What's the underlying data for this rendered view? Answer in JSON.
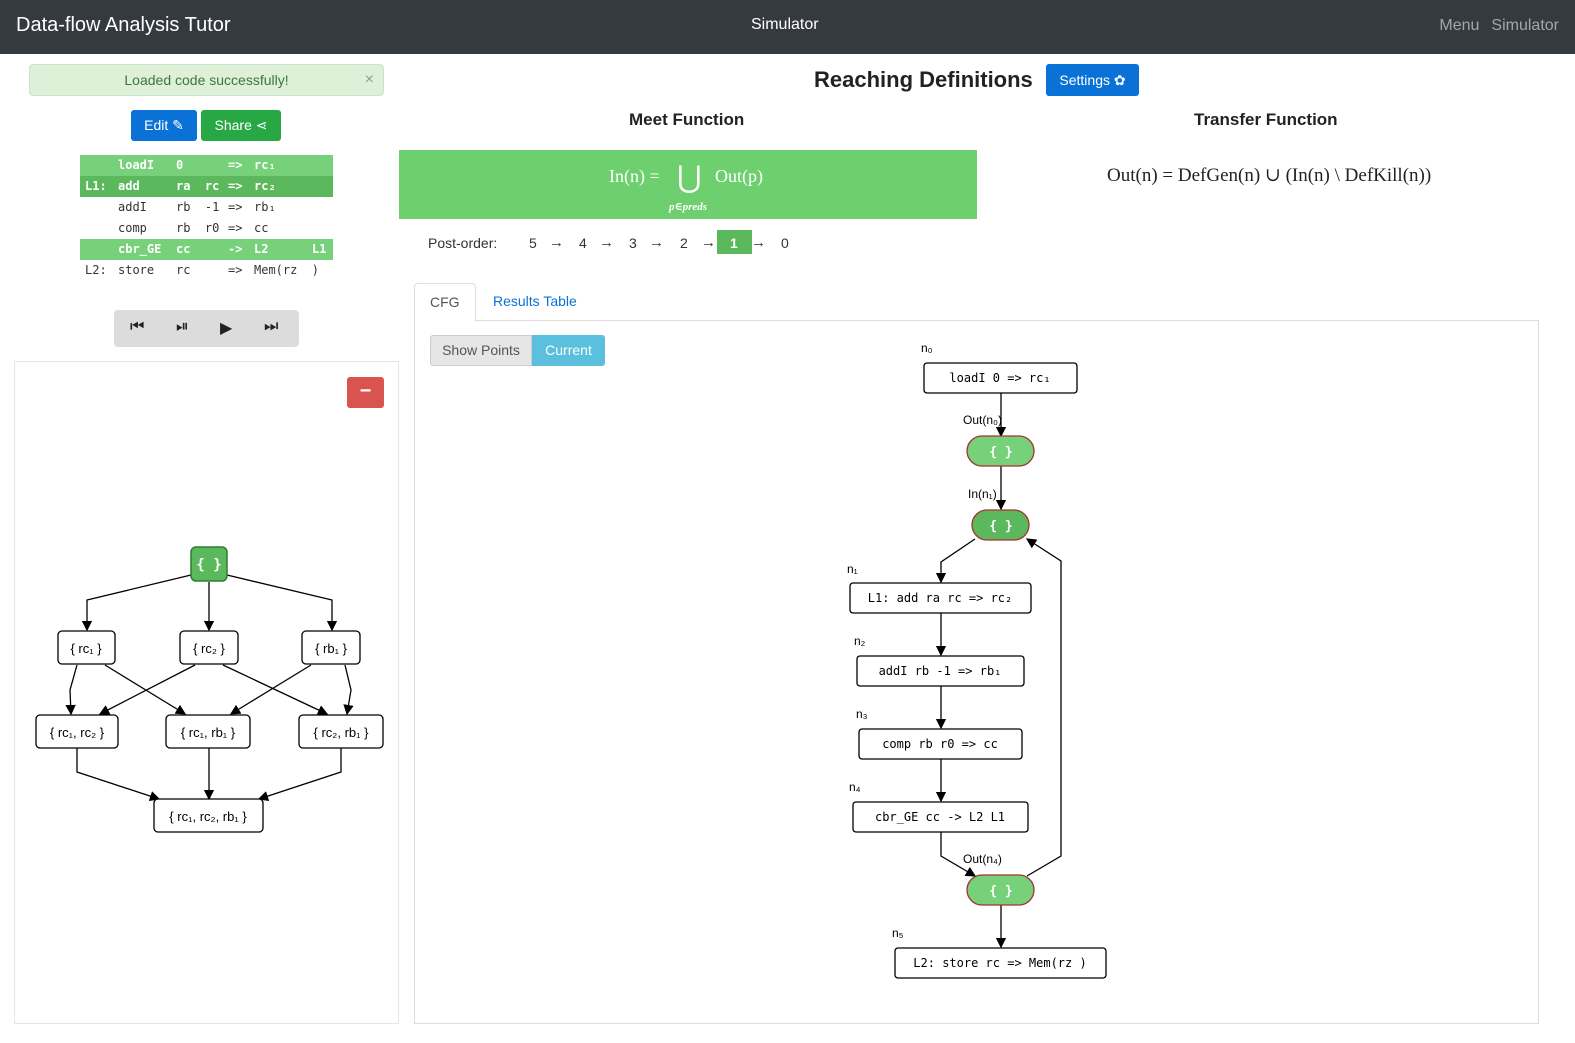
{
  "navbar": {
    "brand": "Data-flow Analysis Tutor",
    "center_title": "Simulator",
    "menu_label": "Menu",
    "simulator_label": "Simulator"
  },
  "alert": {
    "message": "Loaded code successfully!",
    "close": "×"
  },
  "toolbar": {
    "edit_label": "Edit ✎",
    "share_label": "Share ⋖"
  },
  "code_lines": [
    {
      "label": "",
      "op": "loadI",
      "args": "0",
      "arrow": "=>",
      "dest": "rc₁",
      "extra": "",
      "highlight": "light"
    },
    {
      "label": "L1:",
      "op": "add",
      "args": "ra  rc",
      "arrow": "=>",
      "dest": "rc₂",
      "extra": "",
      "highlight": "dark"
    },
    {
      "label": "",
      "op": "addI",
      "args": "rb  -1",
      "arrow": "=>",
      "dest": "rb₁",
      "extra": "",
      "highlight": "none"
    },
    {
      "label": "",
      "op": "comp",
      "args": "rb  r0",
      "arrow": "=>",
      "dest": "cc",
      "extra": "",
      "highlight": "none"
    },
    {
      "label": "",
      "op": "cbr_GE",
      "args": "cc",
      "arrow": "->",
      "dest": "L2",
      "extra": "L1",
      "highlight": "light"
    },
    {
      "label": "L2:",
      "op": "store",
      "args": "rc",
      "arrow": "=>",
      "dest": "Mem(rz  )",
      "extra": "",
      "highlight": "none"
    }
  ],
  "player": {
    "first": "⏮",
    "step": "⏯",
    "play": "▶",
    "last": "⏭"
  },
  "lattice": {
    "minus_label": "−",
    "top": "{ }",
    "level1": [
      "{ rc₁ }",
      "{ rc₂ }",
      "{ rb₁ }"
    ],
    "level2": [
      "{ rc₁, rc₂ }",
      "{ rc₁, rb₁ }",
      "{ rc₂, rb₁ }"
    ],
    "bottom": "{ rc₁, rc₂, rb₁ }"
  },
  "analysis": {
    "title": "Reaching Definitions",
    "settings_label": "Settings ✿",
    "meet_title": "Meet Function",
    "transfer_title": "Transfer Function",
    "meet_lhs": "In(n) =",
    "meet_cup": "⋃",
    "meet_sub": "p∈preds",
    "meet_rhs": "Out(p)",
    "transfer_formula": "Out(n) = DefGen(n) ∪ (In(n) \\ DefKill(n))"
  },
  "postorder": {
    "label": "Post-order:",
    "items": [
      "5",
      "4",
      "3",
      "2",
      "1",
      "0"
    ],
    "arrow": "→",
    "active_index": 4
  },
  "tabs": {
    "cfg": "CFG",
    "results": "Results Table"
  },
  "cfg_controls": {
    "show_points": "Show Points",
    "current": "Current"
  },
  "cfg": {
    "n0_label": "n₀",
    "n0_code": "loadI  0   =>  rc₁",
    "out_n0_label": "Out(n₀)",
    "out_n0_set": "{ }",
    "in_n1_label": "In(n₁)",
    "in_n1_set": "{ }",
    "n1_label": "n₁",
    "n1_code": "L1:  add  ra  rc  =>  rc₂",
    "n2_label": "n₂",
    "n2_code": "addI  rb  -1  =>  rb₁",
    "n3_label": "n₃",
    "n3_code": "comp  rb  r0  =>  cc",
    "n4_label": "n₄",
    "n4_code": "cbr_GE  cc   ->  L2  L1",
    "out_n4_label": "Out(n₄)",
    "out_n4_set": "{ }",
    "n5_label": "n₅",
    "n5_code": "L2:  store  rc   =>  Mem(rz  )"
  },
  "colors": {
    "navbar": "#343a40",
    "primary": "#0a72d6",
    "success": "#28a745",
    "highlight_light": "#76d17a",
    "highlight_dark": "#5cb85c",
    "danger": "#d9534f",
    "info": "#5bc0de",
    "point_border": "#a33333"
  }
}
